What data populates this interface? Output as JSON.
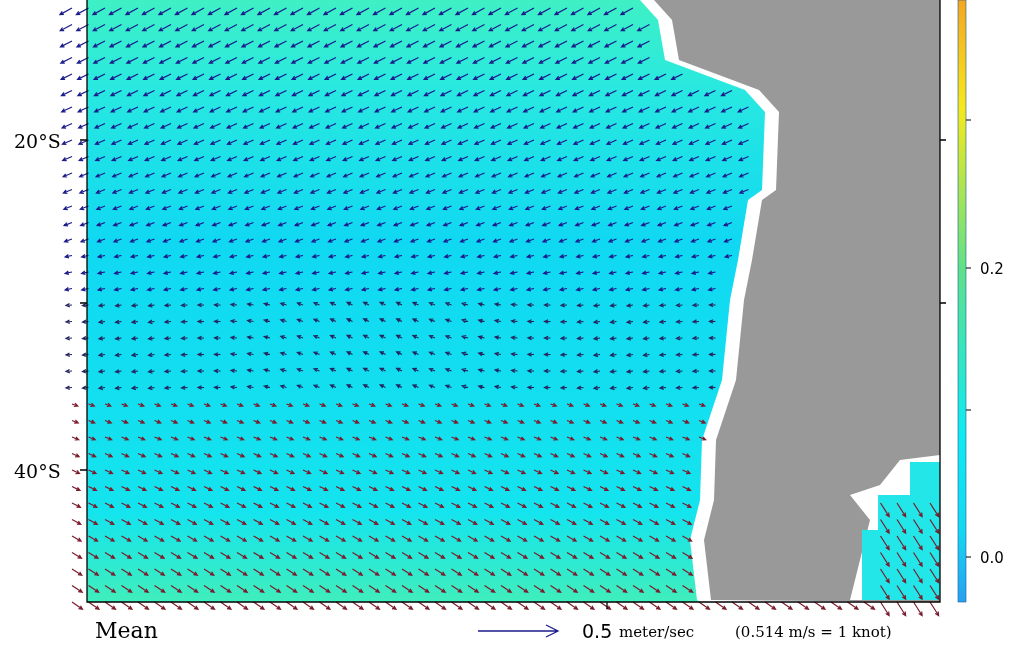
{
  "plot": {
    "y_axis_labels": [
      "20°S",
      "40°S"
    ],
    "colorbar": {
      "tick_labels": [
        "0.2",
        "0.0"
      ]
    },
    "caption": "Mean",
    "legend": {
      "scale_value": "0.5",
      "unit": "meter/sec",
      "note": "(0.514 m/s = 1 knot)"
    }
  }
}
